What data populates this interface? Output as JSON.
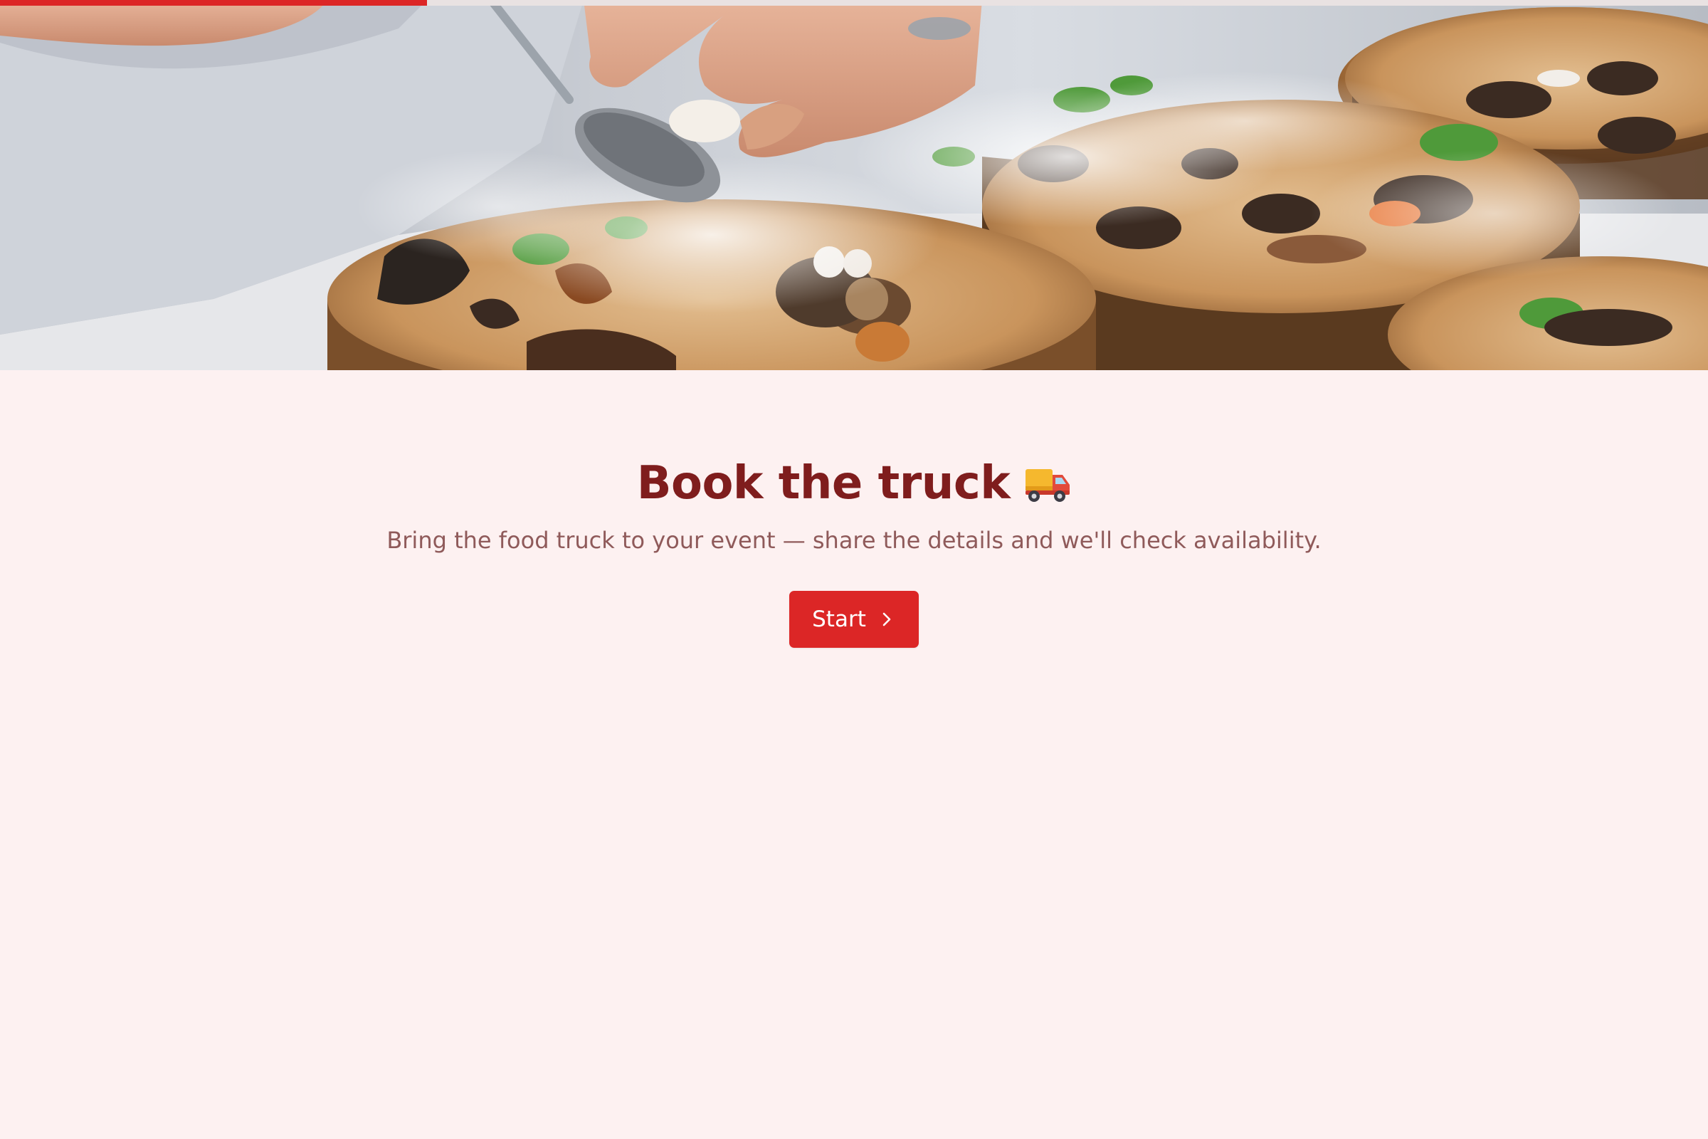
{
  "progress": {
    "fraction": 0.25,
    "color": "#dc2626"
  },
  "hero": {
    "image_icon": "chef-plating-food-photo"
  },
  "main": {
    "title": "Book the truck",
    "title_icon": "delivery-truck-icon",
    "subtitle": "Bring the food truck to your event — share the details and we'll check availability.",
    "start_label": "Start",
    "start_icon": "chevron-right-icon"
  },
  "colors": {
    "background": "#fdf1f1",
    "accent": "#dc2626",
    "title": "#7f1d1d",
    "subtitle": "#8f5a5a"
  }
}
